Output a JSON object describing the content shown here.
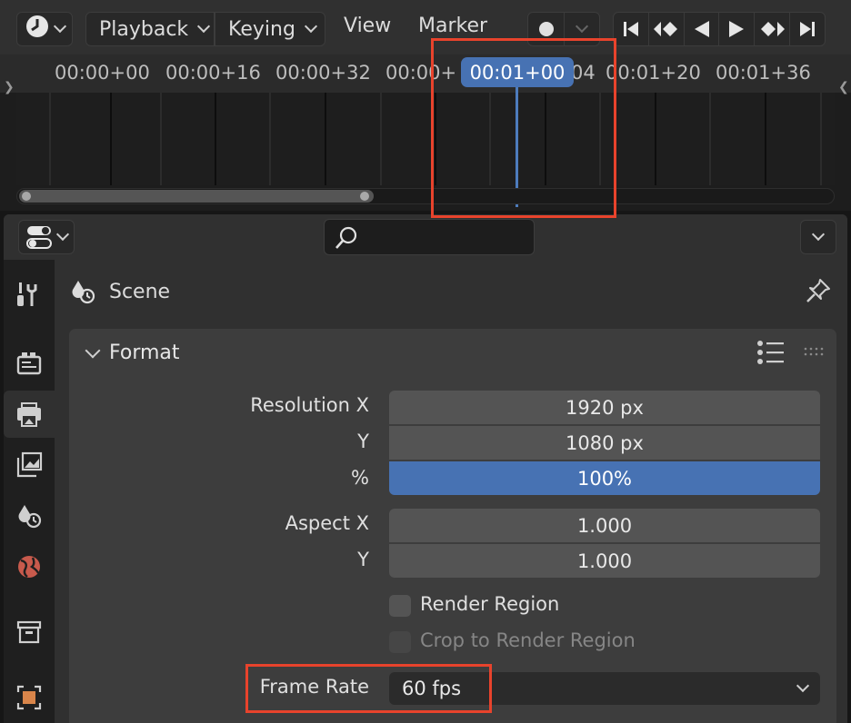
{
  "timeline": {
    "menus": [
      "Playback",
      "Keying",
      "View",
      "Marker"
    ],
    "ruler_labels": [
      "00:00+00",
      "00:00+16",
      "00:00+32",
      "00:00+",
      "04",
      "00:01+20",
      "00:01+36"
    ],
    "current_time": "00:01+00"
  },
  "properties": {
    "search": {
      "value": "",
      "placeholder": ""
    },
    "context": "Scene",
    "panel_title": "Format",
    "resolution_x_label": "Resolution X",
    "resolution_x": "1920 px",
    "resolution_y_label": "Y",
    "resolution_y": "1080 px",
    "resolution_pct_label": "%",
    "resolution_pct": "100%",
    "aspect_x_label": "Aspect X",
    "aspect_x": "1.000",
    "aspect_y_label": "Y",
    "aspect_y": "1.000",
    "render_region_label": "Render Region",
    "crop_label": "Crop to Render Region",
    "frame_rate_label": "Frame Rate",
    "frame_rate": "60 fps"
  },
  "colors": {
    "accent": "#4772b3",
    "highlight": "#e8432c"
  }
}
